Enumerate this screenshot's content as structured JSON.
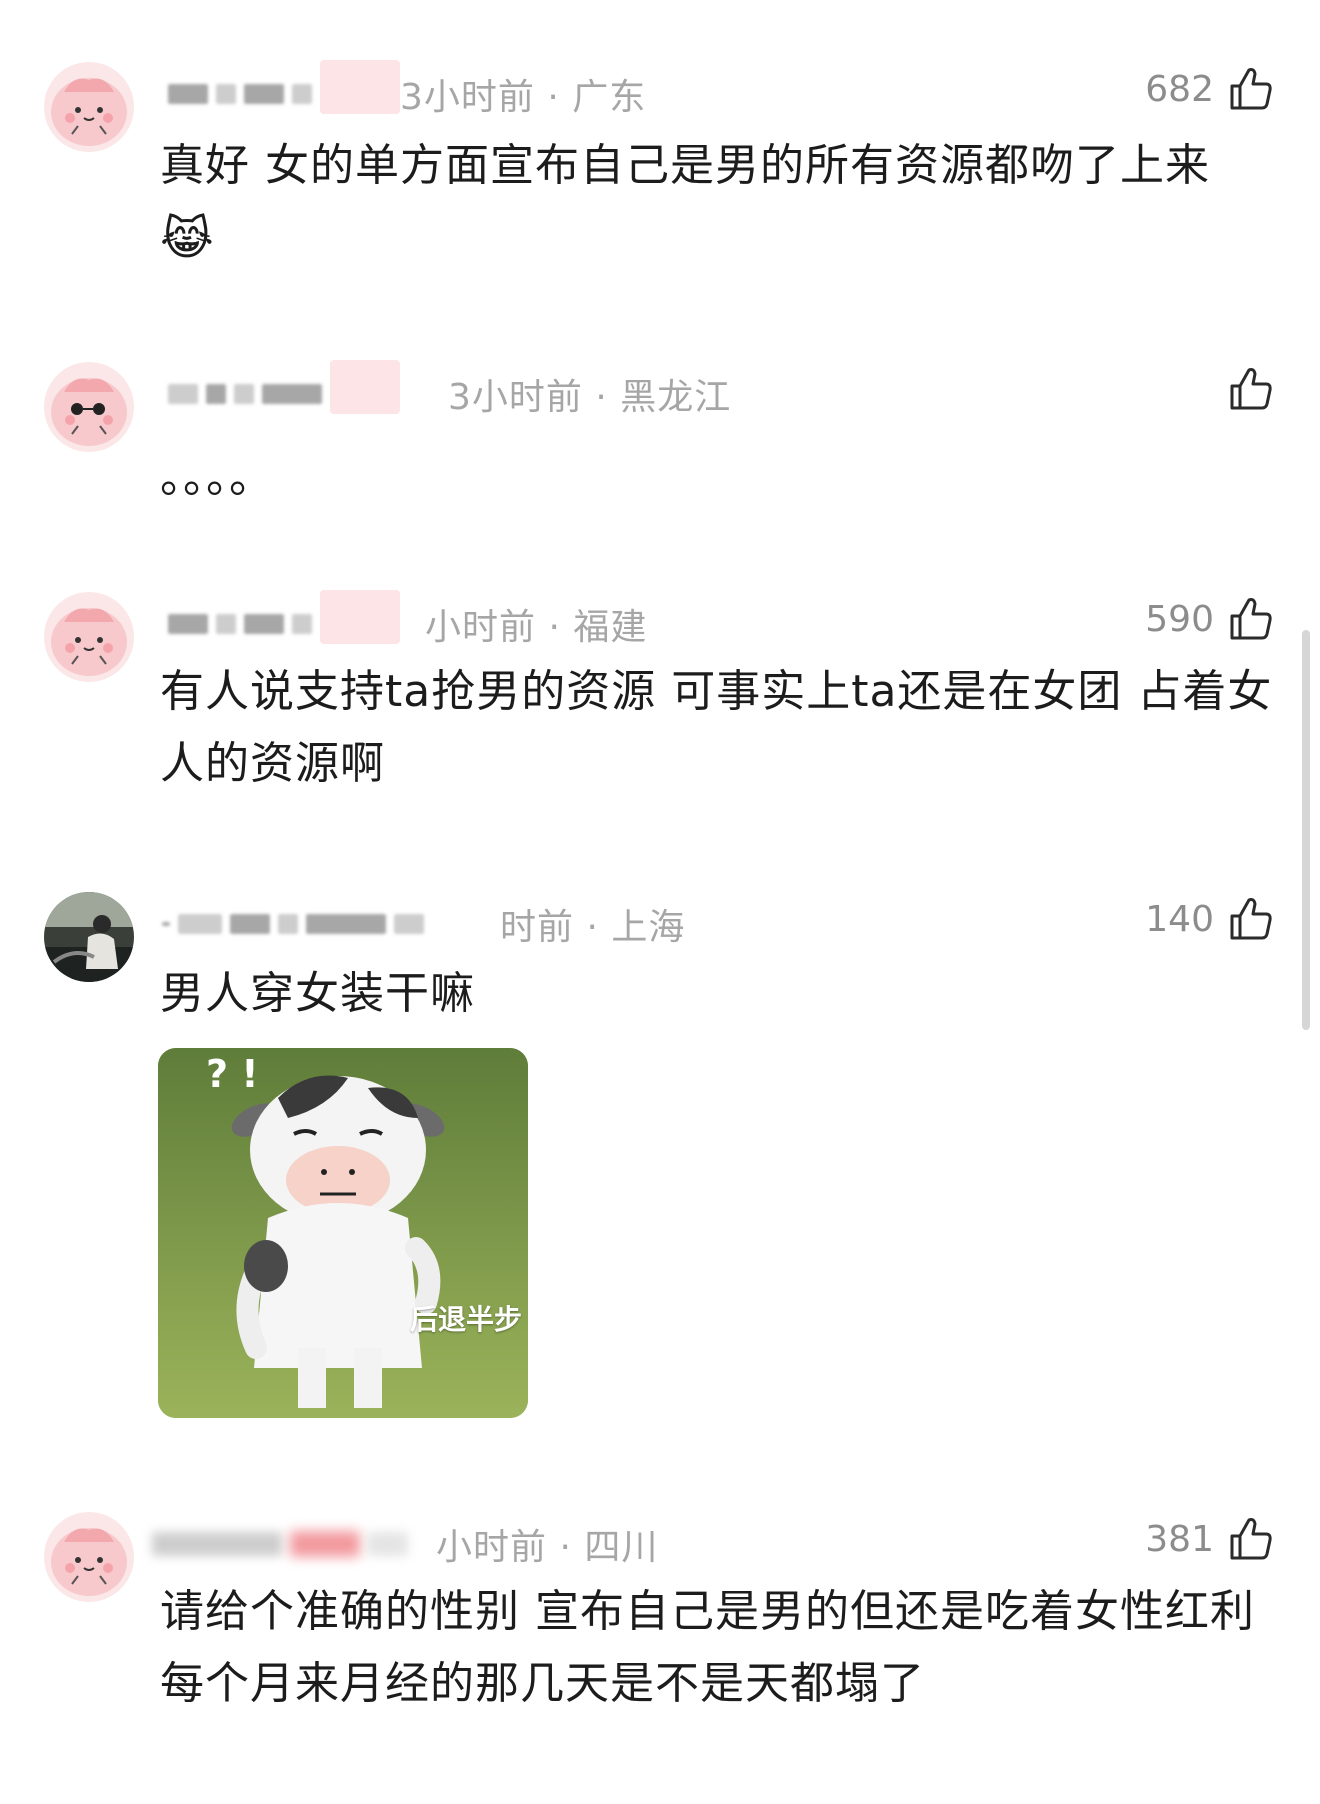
{
  "comments": [
    {
      "meta": "3小时前 · 广东",
      "likes": "682",
      "text": "真好 女的单方面宣布自己是男的所有资源都吻了上来",
      "emoji": "😹"
    },
    {
      "meta": "3小时前 · 黑龙江",
      "likes": "",
      "text": "。。。。"
    },
    {
      "meta": "小时前 · 福建",
      "likes": "590",
      "text": "有人说支持ta抢男的资源 可事实上ta还是在女团 占着女人的资源啊"
    },
    {
      "meta": "时前 · 上海",
      "likes": "140",
      "text": "男人穿女装干嘛",
      "sticker": {
        "marks": "? !",
        "caption": "后退半步"
      }
    },
    {
      "meta": "小时前 · 四川",
      "likes": "381",
      "text": "请给个准确的性别 宣布自己是男的但还是吃着女性红利 每个月来月经的那几天是不是天都塌了"
    }
  ],
  "icons": {
    "like": "thumbs-up-icon",
    "avatar": "pink-blob-avatar",
    "photo_avatar": "person-photo-avatar"
  },
  "colors": {
    "meta_text": "#a6a6a6",
    "body_text": "#1c1c1c",
    "avatar_pink": "#f7c9cc",
    "badge_red": "#e8474f"
  }
}
